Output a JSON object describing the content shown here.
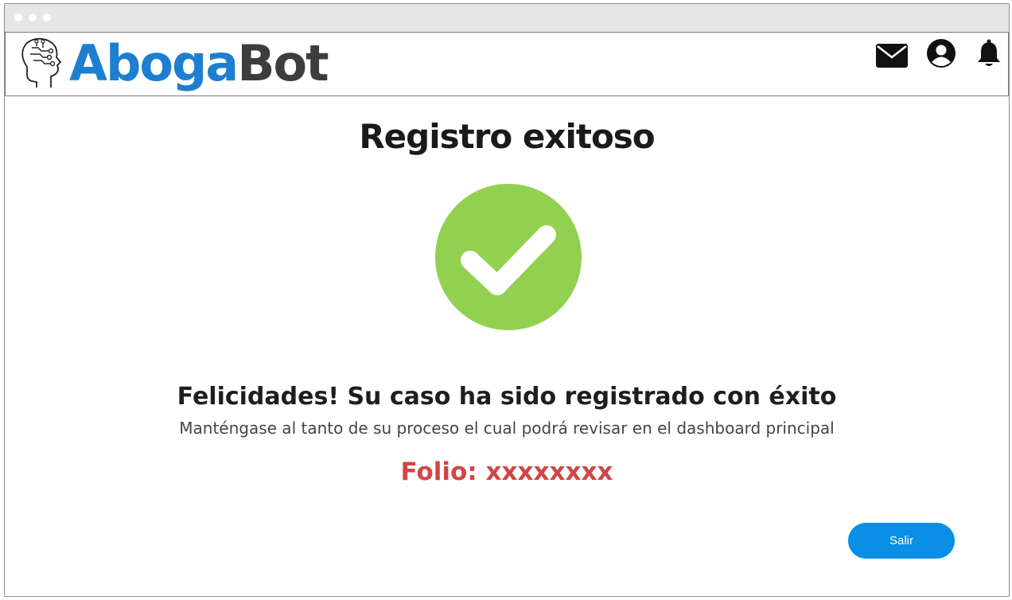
{
  "brand": {
    "part1": "Aboga",
    "part2": "Bot",
    "color_primary": "#1e7fd1",
    "color_secondary": "#3d3d3d"
  },
  "header_icons": [
    "envelope-icon",
    "user-circle-icon",
    "bell-icon"
  ],
  "main": {
    "title": "Registro exitoso",
    "status_icon": "check-circle-icon",
    "status_color": "#92d050",
    "congrats": "Felicidades! Su caso ha sido registrado con éxito",
    "subtext": "Manténgase al tanto de su proceso el cual podrá revisar en el dashboard principal",
    "folio": "Folio: xxxxxxxx",
    "folio_color": "#d14646"
  },
  "actions": {
    "exit_label": "Salir",
    "button_color": "#0a8fe6"
  }
}
